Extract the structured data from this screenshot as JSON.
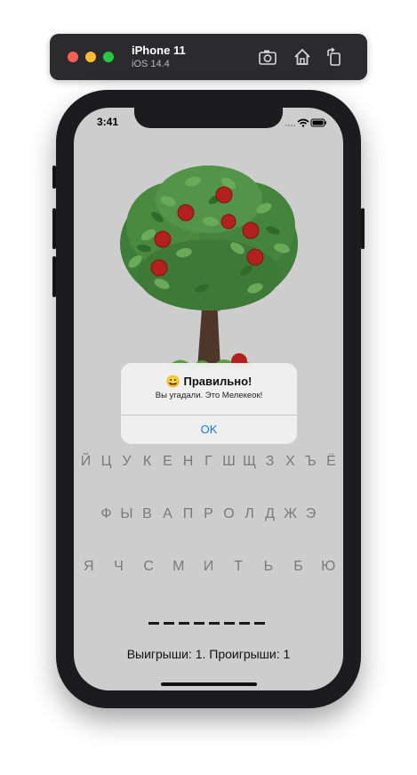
{
  "simulator": {
    "device_name": "iPhone 11",
    "os_version": "iOS 14.4",
    "icons": [
      "screenshot-icon",
      "home-icon",
      "rotate-icon"
    ]
  },
  "status_bar": {
    "time": "3:41"
  },
  "alert": {
    "emoji": "😀",
    "title": "Правильно!",
    "message": "Вы угадали. Это Мелекеок!",
    "ok_label": "OK"
  },
  "keyboard": {
    "row1": [
      "Й",
      "Ц",
      "У",
      "К",
      "Е",
      "Н",
      "Г",
      "Ш",
      "Щ",
      "З",
      "Х",
      "Ъ",
      "Ё"
    ],
    "row2": [
      "Ф",
      "Ы",
      "В",
      "А",
      "П",
      "Р",
      "О",
      "Л",
      "Д",
      "Ж",
      "Э"
    ],
    "row3": [
      "Я",
      "Ч",
      "С",
      "М",
      "И",
      "Т",
      "Ь",
      "Б",
      "Ю"
    ]
  },
  "word": {
    "slots": 8
  },
  "score": "Выигрыши: 1. Проигрыши: 1",
  "colors": {
    "screen_bg": "#cdcdcd",
    "alert_button": "#1b74e8",
    "key_text": "#7a7a7a"
  }
}
